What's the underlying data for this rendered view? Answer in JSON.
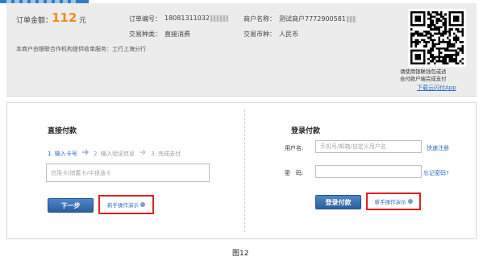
{
  "order": {
    "amount_label": "订单金额：",
    "amount_value": "112",
    "amount_unit": "元",
    "order_no_label": "订单编号：",
    "order_no_value": "18081311032",
    "merchant_label": "商户名称：",
    "merchant_value": "测试商户7772900581",
    "trade_type_label": "交易种类：",
    "trade_type_value": "直接消费",
    "currency_label": "交易币种：",
    "currency_value": "人民币",
    "notice": "本商户由银联合作机构提供收单服务：工行上海分行"
  },
  "qr": {
    "line1": "请使用银联钱包或适",
    "line2": "合付款户端完成支付",
    "download_link": "下载云闪付App"
  },
  "direct_pay": {
    "title": "直接付款",
    "steps": [
      "1. 输入卡号",
      "2. 输入验证信息",
      "3. 完成支付"
    ],
    "card_placeholder": "信用卡/储蓄卡/中银通卡",
    "next_button": "下一步",
    "demo_link": "新手操作演示"
  },
  "login_pay": {
    "title": "登录付款",
    "username_label": "用户名:",
    "username_placeholder": "手机号/邮箱/自定义用户名",
    "quick_register": "快速注册",
    "password_label": "密　码:",
    "forgot_password": "忘记密码?",
    "login_button": "登录付款",
    "demo_link": "新手操作演示"
  },
  "caption": "图12",
  "colors": {
    "amount": "#f28c1b",
    "link": "#2a6dc2",
    "button": "#2b5f9e",
    "highlight_box": "#e02020"
  }
}
